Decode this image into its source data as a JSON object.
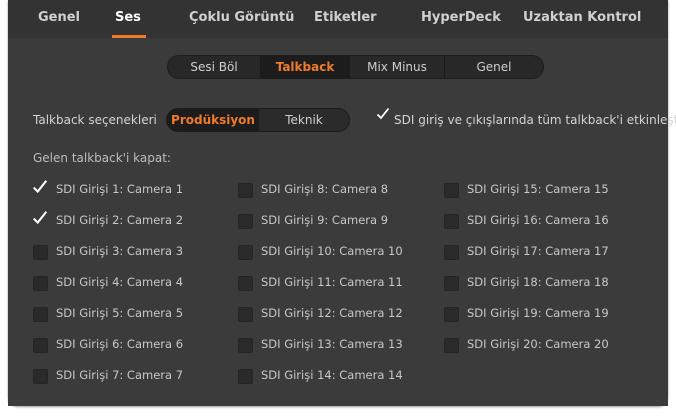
{
  "tabs": [
    {
      "label": "Genel",
      "active": false
    },
    {
      "label": "Ses",
      "active": true
    },
    {
      "label": "Çoklu Görüntü",
      "active": false
    },
    {
      "label": "Etiketler",
      "active": false
    },
    {
      "label": "HyperDeck",
      "active": false
    },
    {
      "label": "Uzaktan Kontrol",
      "active": false
    }
  ],
  "subtabs": [
    {
      "label": "Sesi Böl",
      "active": false
    },
    {
      "label": "Talkback",
      "active": true
    },
    {
      "label": "Mix Minus",
      "active": false
    },
    {
      "label": "Genel",
      "active": false
    }
  ],
  "talkback_options": {
    "label": "Talkback seçenekleri",
    "options": [
      {
        "label": "Prodüksiyon",
        "active": true
      },
      {
        "label": "Teknik",
        "active": false
      }
    ],
    "sdi_enable": {
      "label": "SDI giriş ve çıkışlarında tüm talkback'i etkinleşt",
      "checked": true
    }
  },
  "mute_section": {
    "title": "Gelen talkback'i kapat:",
    "inputs": [
      {
        "label": "SDI Girişi 1: Camera 1",
        "checked": true
      },
      {
        "label": "SDI Girişi 2: Camera 2",
        "checked": true
      },
      {
        "label": "SDI Girişi 3: Camera 3",
        "checked": false
      },
      {
        "label": "SDI Girişi 4: Camera 4",
        "checked": false
      },
      {
        "label": "SDI Girişi 5: Camera 5",
        "checked": false
      },
      {
        "label": "SDI Girişi 6: Camera 6",
        "checked": false
      },
      {
        "label": "SDI Girişi 7: Camera 7",
        "checked": false
      },
      {
        "label": "SDI Girişi 8: Camera 8",
        "checked": false
      },
      {
        "label": "SDI Girişi 9: Camera 9",
        "checked": false
      },
      {
        "label": "SDI Girişi 10: Camera 10",
        "checked": false
      },
      {
        "label": "SDI Girişi 11: Camera 11",
        "checked": false
      },
      {
        "label": "SDI Girişi 12: Camera 12",
        "checked": false
      },
      {
        "label": "SDI Girişi 13: Camera 13",
        "checked": false
      },
      {
        "label": "SDI Girişi 14: Camera 14",
        "checked": false
      },
      {
        "label": "SDI Girişi 15: Camera 15",
        "checked": false
      },
      {
        "label": "SDI Girişi 16: Camera 16",
        "checked": false
      },
      {
        "label": "SDI Girişi 17: Camera 17",
        "checked": false
      },
      {
        "label": "SDI Girişi 18: Camera 18",
        "checked": false
      },
      {
        "label": "SDI Girişi 19: Camera 19",
        "checked": false
      },
      {
        "label": "SDI Girişi 20: Camera 20",
        "checked": false
      }
    ]
  },
  "colors": {
    "accent": "#f07a2a",
    "panel_bg": "#3b3b3b",
    "tab_bg": "#333333"
  }
}
